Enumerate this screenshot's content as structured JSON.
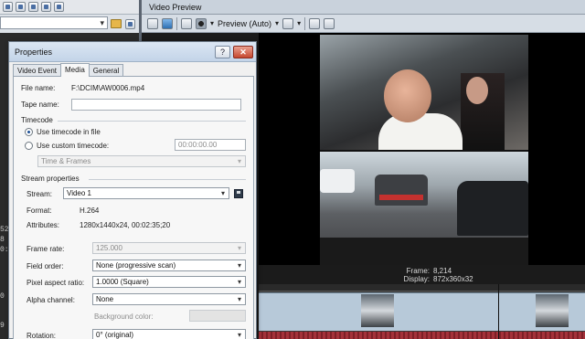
{
  "left_panel": {
    "side_numbers": [
      "52",
      "8",
      "0:",
      "0",
      "9"
    ]
  },
  "video_preview": {
    "title": "Video Preview",
    "preview_mode": "Preview (Auto)",
    "frame_label": "Frame:",
    "frame_value": "8,214",
    "display_label": "Display:",
    "display_value": "872x360x32"
  },
  "dialog": {
    "title": "Properties",
    "help": "?",
    "close": "✕",
    "tabs": [
      "Video Event",
      "Media",
      "General"
    ],
    "active_tab": "Media",
    "file_name_label": "File name:",
    "file_name_value": "F:\\DCIM\\AW0006.mp4",
    "tape_name_label": "Tape name:",
    "tape_name_value": "",
    "timecode_group": "Timecode",
    "use_timecode_in_file": "Use timecode in file",
    "use_custom_timecode": "Use custom timecode:",
    "custom_timecode_value": "00:00:00.00",
    "timecode_format": "Time & Frames",
    "stream_properties_group": "Stream properties",
    "stream_label": "Stream:",
    "stream_value": "Video 1",
    "format_label": "Format:",
    "format_value": "H.264",
    "attributes_label": "Attributes:",
    "attributes_value": "1280x1440x24, 00:02:35;20",
    "frame_rate_label": "Frame rate:",
    "frame_rate_value": "125.000",
    "field_order_label": "Field order:",
    "field_order_value": "None (progressive scan)",
    "pixel_aspect_label": "Pixel aspect ratio:",
    "pixel_aspect_value": "1.0000 (Square)",
    "alpha_channel_label": "Alpha channel:",
    "alpha_channel_value": "None",
    "background_color_label": "Background color:",
    "rotation_label": "Rotation:",
    "rotation_value": "0° (original)"
  }
}
